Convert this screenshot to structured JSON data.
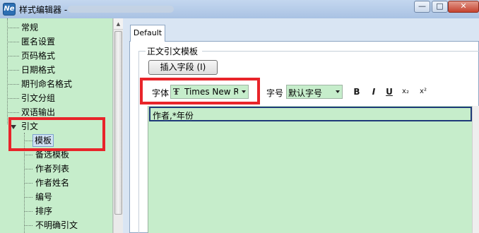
{
  "window": {
    "title": "样式编辑器 -",
    "minimize": "—",
    "maximize": "□",
    "close": "✕"
  },
  "tree": {
    "items": [
      {
        "label": "常规"
      },
      {
        "label": "匿名设置"
      },
      {
        "label": "页码格式"
      },
      {
        "label": "日期格式"
      },
      {
        "label": "期刊命名格式"
      },
      {
        "label": "引文分组"
      },
      {
        "label": "双语输出"
      },
      {
        "label": "引文"
      },
      {
        "label": "模板",
        "selected": true
      },
      {
        "label": "备选模板"
      },
      {
        "label": "作者列表"
      },
      {
        "label": "作者姓名"
      },
      {
        "label": "编号"
      },
      {
        "label": "排序"
      },
      {
        "label": "不明确引文"
      }
    ]
  },
  "tabs": [
    {
      "label": "Default",
      "active": true
    }
  ],
  "template_group": {
    "title": "正文引文模板",
    "insert_field_button": "插入字段 (I)"
  },
  "toolbar": {
    "font_label": "字体",
    "font_icon": "Ŧ",
    "font_value": "Times New R",
    "size_label": "字号",
    "size_value": "默认字号",
    "bold": "B",
    "italic": "I",
    "underline": "U",
    "subscript": "x₂",
    "superscript": "x²"
  },
  "editor": {
    "content": "作者,*年份"
  },
  "colors": {
    "highlight_green": "#c6edcb",
    "annotation_red": "#e8242a",
    "panel_blue": "#d9e5f3"
  }
}
